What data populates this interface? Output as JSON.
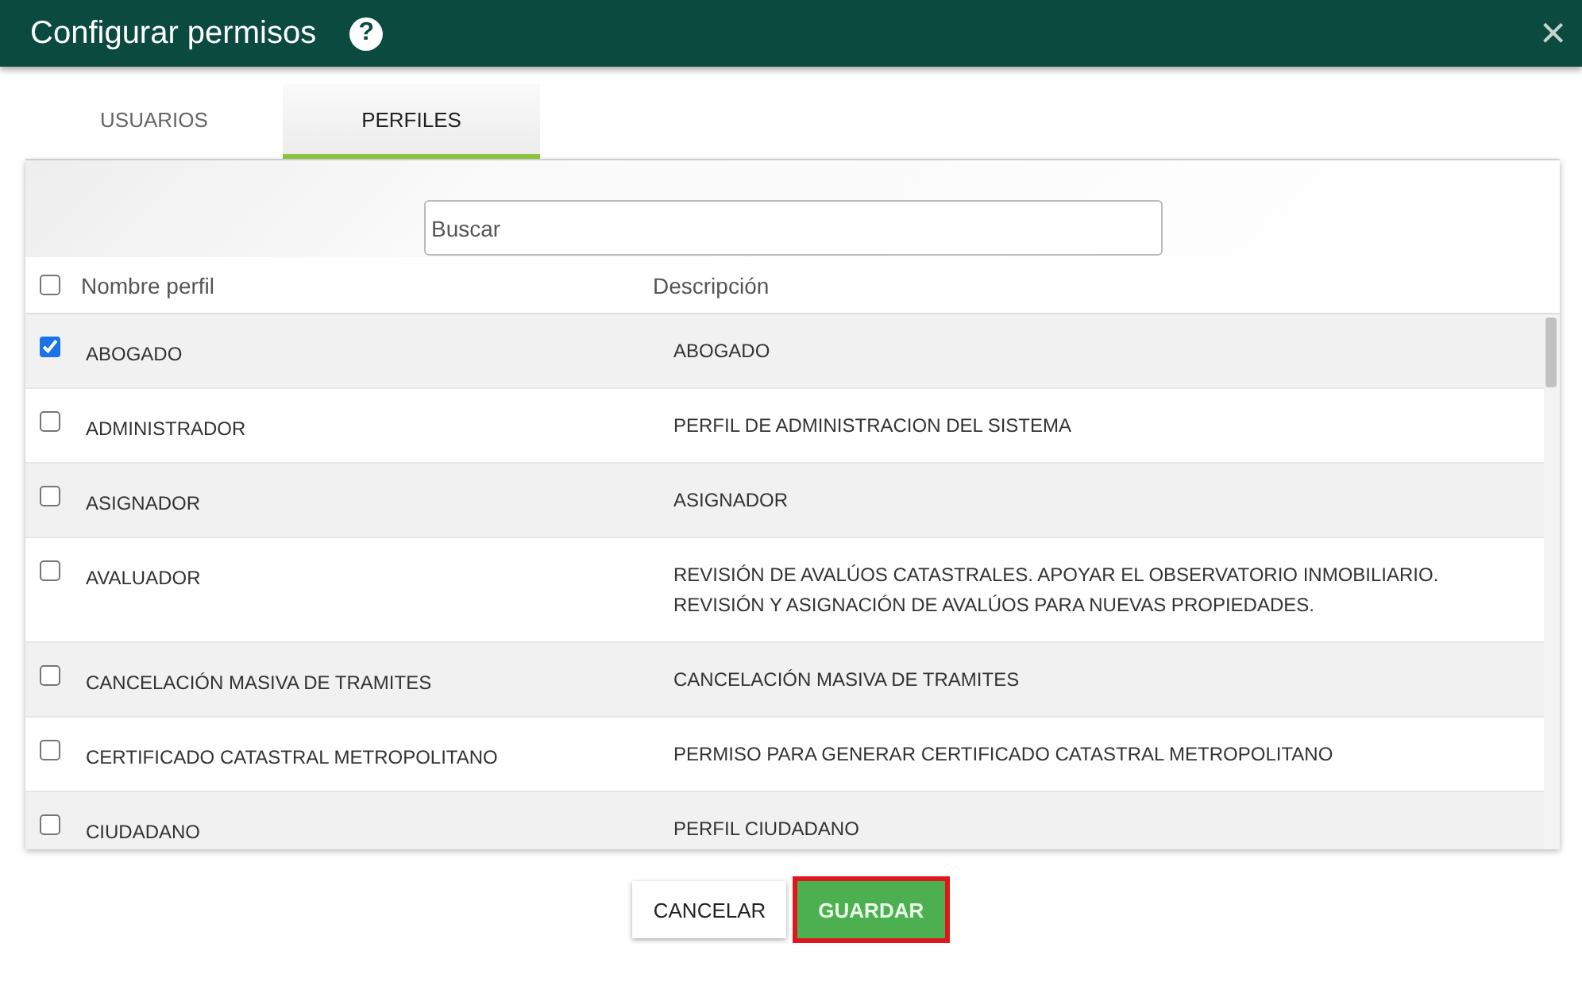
{
  "window": {
    "title": "Configurar permisos",
    "help": "?",
    "close": "×"
  },
  "tabs": [
    {
      "label": "USUARIOS",
      "selected": false
    },
    {
      "label": "PERFILES",
      "selected": true
    }
  ],
  "search": {
    "placeholder": "Buscar"
  },
  "table": {
    "select_all": {
      "checked": false
    },
    "columns": [
      "Nombre perfil",
      "Descripción"
    ],
    "rows": [
      {
        "name": "ABOGADO",
        "description": "ABOGADO",
        "checked": true
      },
      {
        "name": "ADMINISTRADOR",
        "description": "PERFIL DE ADMINISTRACION DEL SISTEMA",
        "checked": false
      },
      {
        "name": "ASIGNADOR",
        "description": "ASIGNADOR",
        "checked": false
      },
      {
        "name": "AVALUADOR",
        "description": "REVISIÓN DE AVALÚOS CATASTRALES. APOYAR EL OBSERVATORIO INMOBILIARIO. REVISIÓN Y ASIGNACIÓN DE AVALÚOS PARA NUEVAS PROPIEDADES.",
        "checked": false
      },
      {
        "name": "CANCELACIÓN MASIVA DE TRAMITES",
        "description": "CANCELACIÓN MASIVA DE TRAMITES",
        "checked": false
      },
      {
        "name": "CERTIFICADO CATASTRAL METROPOLITANO",
        "description": "PERMISO PARA GENERAR CERTIFICADO CATASTRAL METROPOLITANO",
        "checked": false
      },
      {
        "name": "CIUDADANO",
        "description": "PERFIL CIUDADANO",
        "checked": false
      }
    ]
  },
  "buttons": [
    {
      "label": "CANCELAR",
      "kind": "flat",
      "highlighted": false
    },
    {
      "label": "GUARDAR",
      "kind": "primary",
      "highlighted": true
    }
  ]
}
